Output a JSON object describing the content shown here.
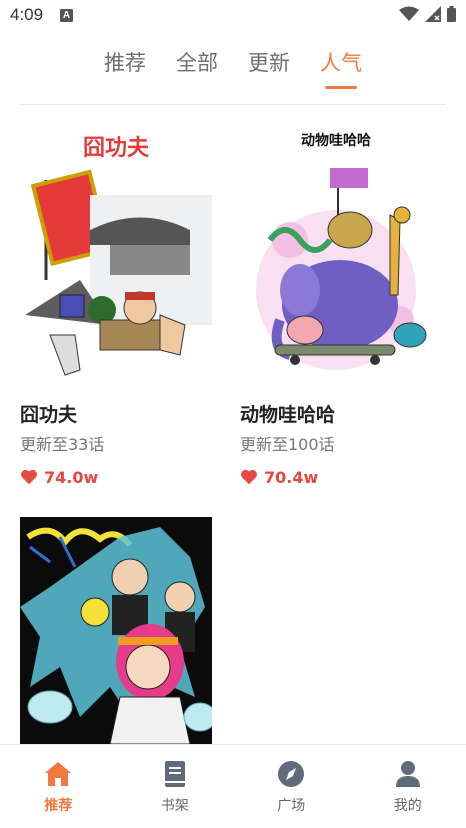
{
  "status_bar": {
    "time": "4:09",
    "notification_letter": "A",
    "icons": [
      "wifi-icon",
      "signal-icon",
      "battery-icon"
    ]
  },
  "tabs": [
    {
      "label": "推荐",
      "active": false
    },
    {
      "label": "全部",
      "active": false
    },
    {
      "label": "更新",
      "active": false
    },
    {
      "label": "人气",
      "active": true
    }
  ],
  "comics": [
    {
      "cover_text": "囧功夫",
      "title": "囧功夫",
      "update": "更新至33话",
      "likes": "74.0w"
    },
    {
      "cover_text": "动物哇哈哈",
      "title": "动物哇哈哈",
      "update": "更新至100话",
      "likes": "70.4w"
    },
    {
      "cover_text": "",
      "title": "",
      "update": "",
      "likes": ""
    }
  ],
  "bottom_nav": [
    {
      "label": "推荐",
      "icon": "home-icon",
      "active": true
    },
    {
      "label": "书架",
      "icon": "book-icon",
      "active": false
    },
    {
      "label": "广场",
      "icon": "compass-icon",
      "active": false
    },
    {
      "label": "我的",
      "icon": "user-icon",
      "active": false
    }
  ],
  "colors": {
    "accent": "#f2783f",
    "like": "#e5493f",
    "nav_inactive": "#5f6b7a"
  }
}
